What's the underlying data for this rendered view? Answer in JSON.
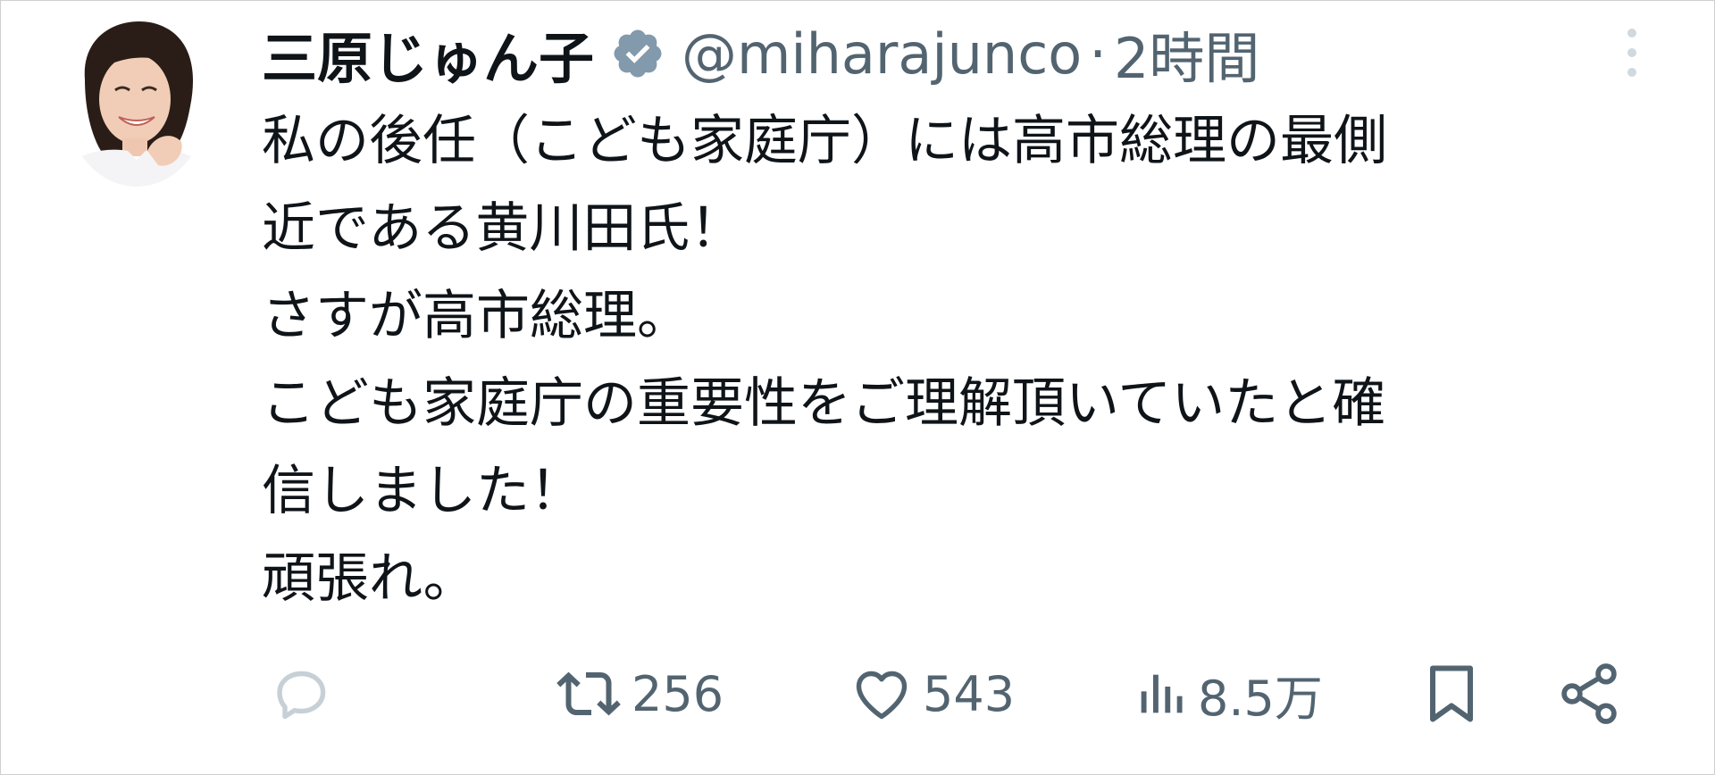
{
  "tweet": {
    "author": {
      "display_name": "三原じゅん子",
      "handle": "@miharajunco",
      "verified_badge_icon": "verified-badge-icon"
    },
    "separator": "·",
    "time": "2時間",
    "more_icon": "more-vertical-icon",
    "text_lines": [
      "私の後任（こども家庭庁）には高市総理の最側",
      "近である黄川田氏！",
      "さすが高市総理。",
      "こども家庭庁の重要性をご理解頂いていたと確",
      "信しました！",
      "頑張れ。"
    ],
    "actions": {
      "reply": {
        "icon": "reply-icon",
        "count": ""
      },
      "retweet": {
        "icon": "retweet-icon",
        "count": "256"
      },
      "like": {
        "icon": "heart-icon",
        "count": "543"
      },
      "views": {
        "icon": "views-chart-icon",
        "count": "8.5万"
      },
      "bookmark": {
        "icon": "bookmark-icon"
      },
      "share": {
        "icon": "share-icon"
      }
    }
  },
  "colors": {
    "text_primary": "#0f1419",
    "text_secondary": "#536471",
    "verified_badge": "#829aab",
    "reply_icon": "#c7d0d6"
  }
}
